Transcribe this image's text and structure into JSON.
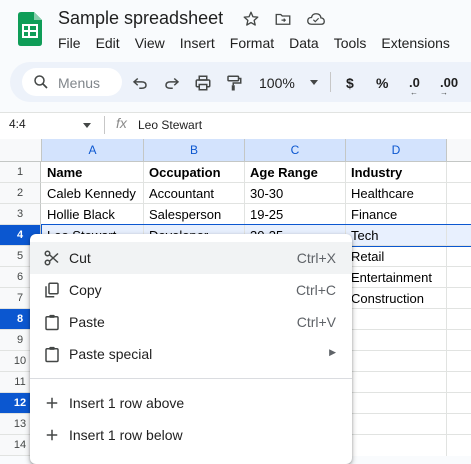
{
  "doc": {
    "title": "Sample spreadsheet"
  },
  "menubar": [
    "File",
    "Edit",
    "View",
    "Insert",
    "Format",
    "Data",
    "Tools",
    "Extensions"
  ],
  "toolbar": {
    "search_placeholder": "Menus",
    "zoom": "100%",
    "currency": "$",
    "percent": "%",
    "dec_decrease": ".0",
    "dec_increase": ".00"
  },
  "formula_bar": {
    "name_box": "4:4",
    "content": "Leo Stewart"
  },
  "grid": {
    "columns": [
      "A",
      "B",
      "C",
      "D"
    ],
    "rows": [
      "1",
      "2",
      "3",
      "4",
      "5",
      "6",
      "7",
      "8",
      "9",
      "10",
      "11",
      "12",
      "13",
      "14"
    ],
    "cells": [
      [
        "Name",
        "Occupation",
        "Age Range",
        "Industry"
      ],
      [
        "Caleb Kennedy",
        "Accountant",
        "30-30",
        "Healthcare"
      ],
      [
        "Hollie Black",
        "Salesperson",
        "19-25",
        "Finance"
      ],
      [
        "Leo Stewart",
        "Developer",
        "30-35",
        "Tech"
      ],
      [
        "",
        "",
        "",
        "Retail"
      ],
      [
        "",
        "",
        "",
        "Entertainment"
      ],
      [
        "",
        "",
        "",
        "Construction"
      ]
    ]
  },
  "context_menu": {
    "cut": {
      "label": "Cut",
      "shortcut": "Ctrl+X"
    },
    "copy": {
      "label": "Copy",
      "shortcut": "Ctrl+C"
    },
    "paste": {
      "label": "Paste",
      "shortcut": "Ctrl+V"
    },
    "paste_special": {
      "label": "Paste special"
    },
    "insert_above": {
      "label": "Insert 1 row above"
    },
    "insert_below": {
      "label": "Insert 1 row below"
    }
  },
  "colors": {
    "accent": "#0b57d0",
    "selection": "#d3e3fd",
    "logo": "#0f9d58"
  }
}
